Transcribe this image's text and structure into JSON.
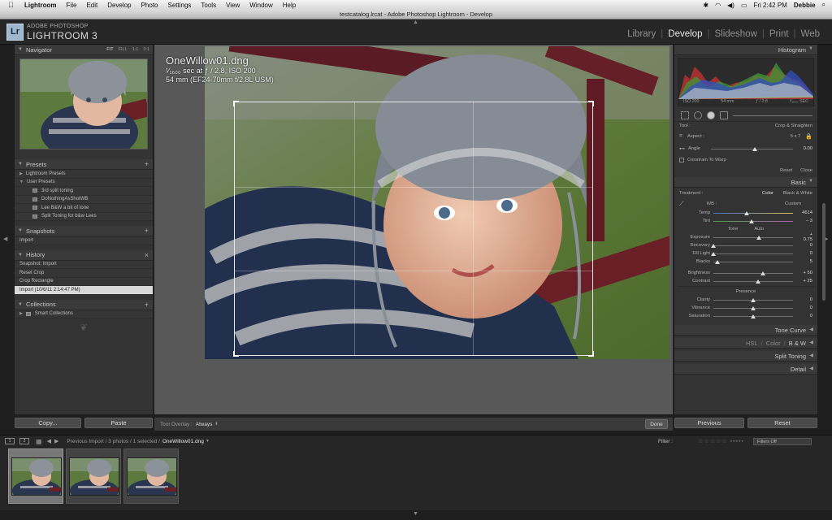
{
  "menubar": {
    "app": "Lightroom",
    "items": [
      "File",
      "Edit",
      "Develop",
      "Photo",
      "Settings",
      "Tools",
      "View",
      "Window",
      "Help"
    ],
    "clock": "Fri 2:42 PM",
    "user": "Debbie"
  },
  "window": {
    "title": "testcatalog.lrcat - Adobe Photoshop Lightroom - Develop"
  },
  "identity": {
    "logo": "Lr",
    "small": "ADOBE PHOTOSHOP",
    "big": "LIGHTROOM 3"
  },
  "modules": [
    {
      "label": "Library",
      "active": false
    },
    {
      "label": "Develop",
      "active": true
    },
    {
      "label": "Slideshow",
      "active": false
    },
    {
      "label": "Print",
      "active": false
    },
    {
      "label": "Web",
      "active": false
    }
  ],
  "left": {
    "navigator": {
      "title": "Navigator",
      "zooms": [
        "FIT",
        "FILL",
        "1:1",
        "3:1"
      ]
    },
    "presets": {
      "title": "Presets",
      "folders": [
        "Lightroom Presets",
        "User Presets"
      ],
      "items": [
        "3rd split toning",
        "DoNothingAsShotWB",
        "Lee B&W a bit of tone",
        "Split Toning for b&w Lees"
      ]
    },
    "snapshots": {
      "title": "Snapshots",
      "items": [
        "Import"
      ]
    },
    "history": {
      "title": "History",
      "items": [
        "Snapshot: Import",
        "Reset Crop",
        "Crop Rectangle",
        "Import (10/6/11 2:14:47 PM)"
      ]
    },
    "collections": {
      "title": "Collections",
      "items": [
        "Smart Collections"
      ]
    },
    "copy_label": "Copy...",
    "paste_label": "Paste"
  },
  "photo": {
    "filename": "OneWillow01.dng",
    "exposure": "¹⁄₁₆₀₀ sec at ƒ / 2.8, ISO 200",
    "lens": "54 mm (EF24-70mm f/2.8L USM)"
  },
  "toolbar": {
    "overlay_label": "Tool Overlay :",
    "overlay_value": "Always",
    "done_label": "Done"
  },
  "right": {
    "histogram": {
      "title": "Histogram",
      "meta": [
        "ISO 200",
        "54 mm",
        "ƒ / 2.8",
        "¹⁄₁₆₀₀ SEC"
      ]
    },
    "crop": {
      "tool_label": "Tool :",
      "tool_name": "Crop & Straighten",
      "aspect_label": "Aspect :",
      "aspect_value": "5 x 7",
      "angle_label": "Angle",
      "angle_value": "0.00",
      "warp_label": "Constrain To Warp",
      "reset": "Reset",
      "close": "Close"
    },
    "basic": {
      "title": "Basic",
      "treatment_label": "Treatment :",
      "color": "Color",
      "bw": "Black & White",
      "wb_label": "WB :",
      "wb_value": "Custom",
      "temp": {
        "label": "Temp",
        "value": "4614",
        "pos": 0.42
      },
      "tint": {
        "label": "Tint",
        "value": "– 3",
        "pos": 0.48
      },
      "tone_label": "Tone",
      "auto": "Auto",
      "tone": [
        {
          "label": "Exposure",
          "value": "+ 0.75",
          "pos": 0.57
        },
        {
          "label": "Recovery",
          "value": "0",
          "pos": 0.0
        },
        {
          "label": "Fill Light",
          "value": "0",
          "pos": 0.0
        },
        {
          "label": "Blacks",
          "value": "5",
          "pos": 0.05
        }
      ],
      "presence_tone": [
        {
          "label": "Brightness",
          "value": "+ 50",
          "pos": 0.62
        },
        {
          "label": "Contrast",
          "value": "+ 25",
          "pos": 0.56
        }
      ],
      "presence_label": "Presence",
      "presence": [
        {
          "label": "Clarity",
          "value": "0",
          "pos": 0.5
        },
        {
          "label": "Vibrance",
          "value": "0",
          "pos": 0.5
        },
        {
          "label": "Saturation",
          "value": "0",
          "pos": 0.5
        }
      ]
    },
    "sections": [
      "Tone Curve",
      "Split Toning",
      "Detail"
    ],
    "hsl": {
      "hsl": "HSL",
      "color": "Color",
      "bw": "B & W"
    },
    "previous": "Previous",
    "reset": "Reset"
  },
  "filmstrip": {
    "pages": [
      "1",
      "2"
    ],
    "source": "Previous Import / 3 photos / 1 selected /",
    "filename": "OneWillow01.dng",
    "filter_label": "Filter :",
    "filter_value": "Filters Off",
    "thumb_count": 3
  }
}
